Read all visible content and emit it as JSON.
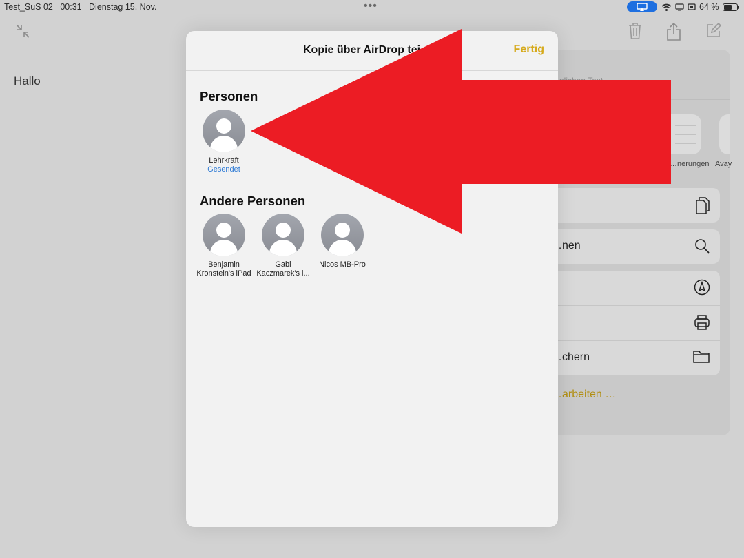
{
  "status_bar": {
    "device": "Test_SuS 02",
    "time": "00:31",
    "date": "Dienstag 15. Nov.",
    "battery": "64 %",
    "battery_level": 0.64,
    "multitask_dots": "•••"
  },
  "note": {
    "text": "Hallo"
  },
  "share_sheet": {
    "caption": "…nlichen Text",
    "apps": [
      {
        "label": "…nerungen",
        "icon": "reminders-icon"
      },
      {
        "label": "Avay",
        "icon": "app-icon"
      }
    ],
    "actions": [
      {
        "label": "",
        "icon": "copy-icon"
      },
      {
        "label": "…nen",
        "icon": "search-icon"
      },
      {
        "label": "",
        "icon": "markup-icon"
      },
      {
        "label": "",
        "icon": "print-icon"
      },
      {
        "label": "…chern",
        "icon": "folder-icon"
      }
    ],
    "edit_label": "…arbeiten …"
  },
  "modal": {
    "title": "Kopie über AirDrop tei…",
    "done_label": "Fertig",
    "sections": {
      "personen": "Personen",
      "andere": "Andere Personen"
    },
    "personen": [
      {
        "name": "Lehrkraft",
        "status": "Gesendet"
      }
    ],
    "andere_personen": [
      {
        "name_line1": "Benjamin",
        "name_line2": "Kronstein's iPad"
      },
      {
        "name_line1": "Gabi",
        "name_line2": "Kaczmarek's i..."
      },
      {
        "name_line1": "Nicos MB-Pro",
        "name_line2": ""
      }
    ]
  },
  "colors": {
    "accent": "#d6aa1c",
    "status_blue": "#2f7bd5",
    "arrow_red": "#ec1c24",
    "airplay_blue": "#1e6fe0"
  }
}
